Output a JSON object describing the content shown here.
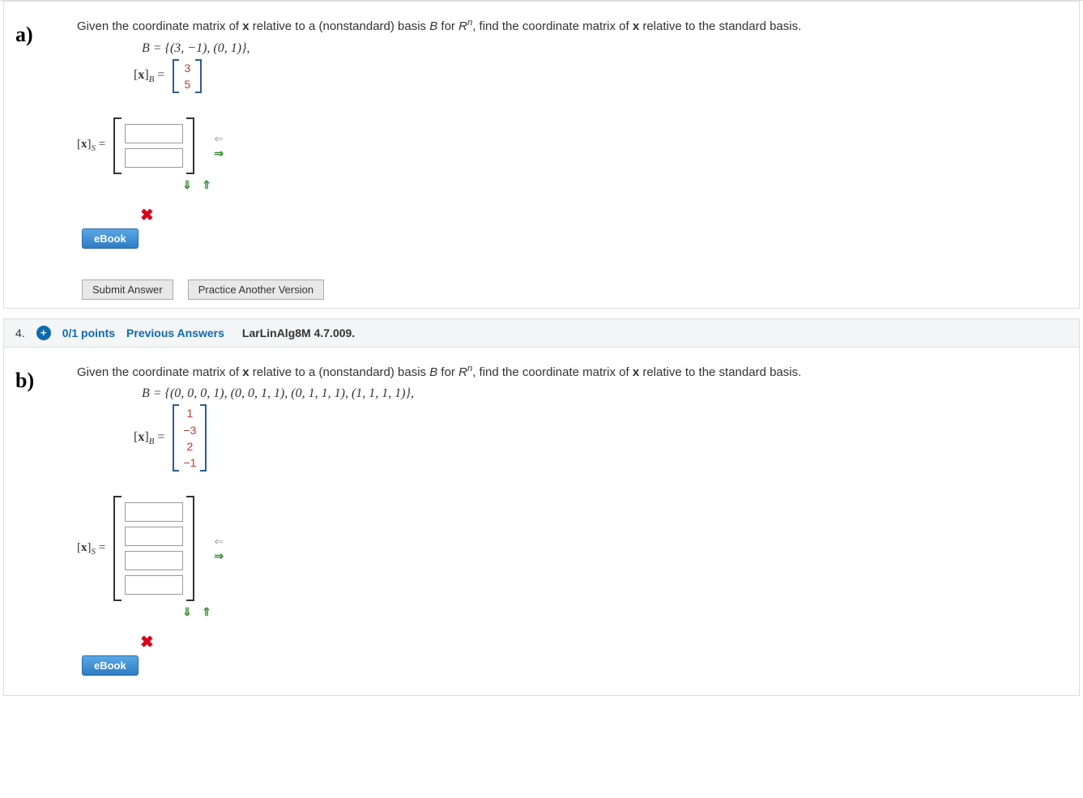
{
  "partA": {
    "label": "a)",
    "prompt_pre": "Given the coordinate matrix of ",
    "prompt_x": "x",
    "prompt_mid1": " relative to a (nonstandard) basis ",
    "prompt_B": "B",
    "prompt_mid2": " for ",
    "prompt_R": "R",
    "prompt_n": "n",
    "prompt_mid3": ", find the coordinate matrix of ",
    "prompt_x2": "x",
    "prompt_end": " relative to the standard basis.",
    "basis_line": "B = {(3, −1), (0, 1)},",
    "xb_label_pre": "[",
    "xb_label_x": "x",
    "xb_label_post": "]",
    "xb_sub": "B",
    "xb_eq": " =",
    "xb_vec": [
      "3",
      "5"
    ],
    "xs_label_pre": "[",
    "xs_label_x": "x",
    "xs_label_post": "]",
    "xs_sub": "S",
    "xs_eq": " =",
    "inputs": 2,
    "ebook": "eBook",
    "submit": "Submit Answer",
    "practice": "Practice Another Version"
  },
  "header4": {
    "num": "4.",
    "plus": "+",
    "points": "0/1 points",
    "prev": "Previous Answers",
    "ref": "LarLinAlg8M 4.7.009."
  },
  "partB": {
    "label": "b)",
    "prompt_pre": "Given the coordinate matrix of ",
    "prompt_x": "x",
    "prompt_mid1": " relative to a (nonstandard) basis ",
    "prompt_B": "B",
    "prompt_mid2": " for ",
    "prompt_R": "R",
    "prompt_n": "n",
    "prompt_mid3": ", find the coordinate matrix of ",
    "prompt_x2": "x",
    "prompt_end": " relative to the standard basis.",
    "basis_line": "B = {(0, 0, 0, 1), (0, 0, 1, 1), (0, 1, 1, 1), (1, 1, 1, 1)},",
    "xb_label_pre": "[",
    "xb_label_x": "x",
    "xb_label_post": "]",
    "xb_sub": "B",
    "xb_eq": " =",
    "xb_vec": [
      "1",
      "−3",
      "2",
      "−1"
    ],
    "xs_label_pre": "[",
    "xs_label_x": "x",
    "xs_label_post": "]",
    "xs_sub": "S",
    "xs_eq": " =",
    "inputs": 4,
    "ebook": "eBook"
  },
  "icons": {
    "arrow_left": "⇐",
    "arrow_right": "⇒",
    "arrow_down": "⇓",
    "arrow_up": "⇑",
    "x_mark": "✖"
  }
}
